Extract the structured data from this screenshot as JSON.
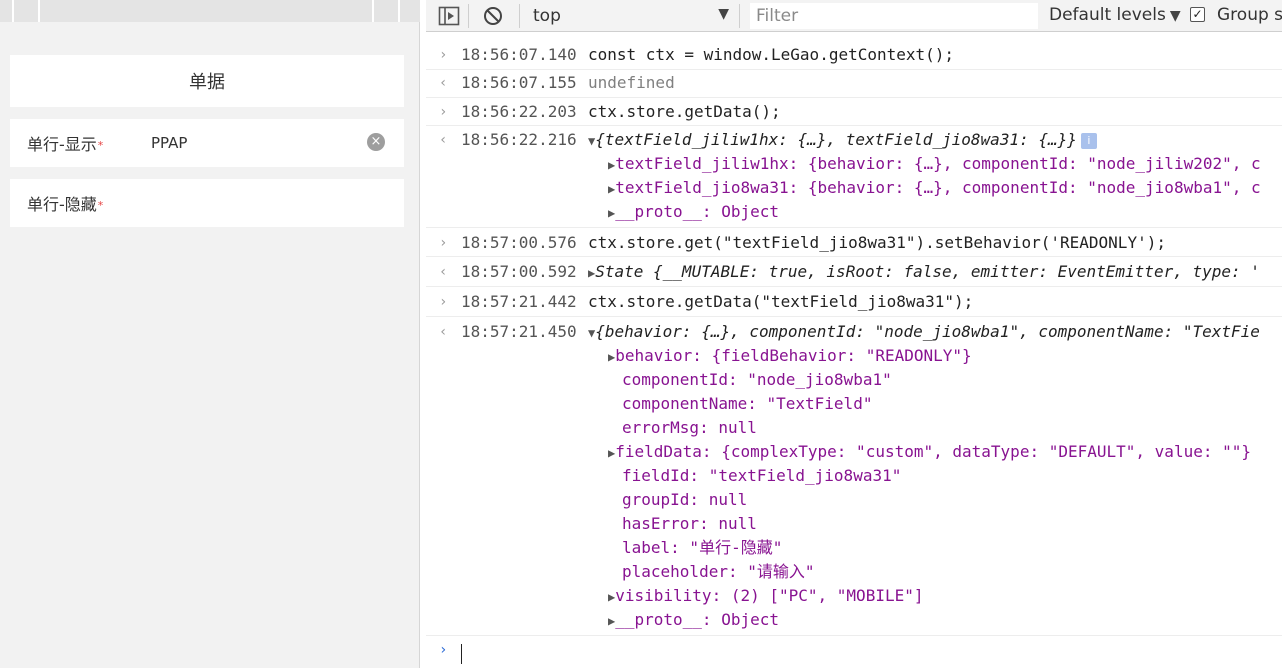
{
  "form": {
    "title": "单据",
    "rows": [
      {
        "label": "单行-显示",
        "required_mark": "*",
        "value": "PPAP",
        "clear_icon": "×"
      },
      {
        "label": "单行-隐藏",
        "required_mark": "*"
      }
    ]
  },
  "devtools": {
    "toolbar": {
      "context": "top",
      "context_arrow": "▼",
      "filter_placeholder": "Filter",
      "levels": "Default levels",
      "levels_arrow": "▼",
      "group_checked": "✓",
      "group_label": "Group si"
    },
    "markers": {
      "input": "›",
      "output": "‹",
      "prompt": "›",
      "expand": "▶",
      "collapse": "▼"
    },
    "messages": [
      {
        "time": "18:56:07.140",
        "code": "const ctx = window.LeGao.getContext();"
      },
      {
        "time": "18:56:07.155",
        "result": "undefined"
      },
      {
        "time": "18:56:22.203",
        "code": "ctx.store.getData();"
      },
      {
        "time": "18:56:22.216",
        "summary": "{textField_jiliw1hx: {…}, textField_jio8wa31: {…}}",
        "info": "i",
        "children": [
          "textField_jiliw1hx: {behavior: {…}, componentId: \"node_jiliw202\", c",
          "textField_jio8wa31: {behavior: {…}, componentId: \"node_jio8wba1\", c",
          "__proto__: Object"
        ]
      },
      {
        "time": "18:57:00.576",
        "code": "ctx.store.get(\"textField_jio8wa31\").setBehavior('READONLY');"
      },
      {
        "time": "18:57:00.592",
        "summary": "State {__MUTABLE: true, isRoot: false, emitter: EventEmitter, type: '"
      },
      {
        "time": "18:57:21.442",
        "code": "ctx.store.getData(\"textField_jio8wa31\");"
      },
      {
        "time": "18:57:21.450",
        "summary": "{behavior: {…}, componentId: \"node_jio8wba1\", componentName: \"TextFie",
        "children": [
          "behavior: {fieldBehavior: \"READONLY\"}",
          "componentId: \"node_jio8wba1\"",
          "componentName: \"TextField\"",
          "errorMsg: null",
          "fieldData: {complexType: \"custom\", dataType: \"DEFAULT\", value: \"\"}",
          "fieldId: \"textField_jio8wa31\"",
          "groupId: null",
          "hasError: null",
          "label: \"单行-隐藏\"",
          "placeholder: \"请输入\"",
          "visibility: (2) [\"PC\", \"MOBILE\"]",
          "__proto__: Object"
        ]
      }
    ]
  },
  "colors": {
    "keyword": "#881391",
    "string": "#c41a16",
    "number": "#1a1aa6",
    "prompt": "#2c6bd6"
  }
}
